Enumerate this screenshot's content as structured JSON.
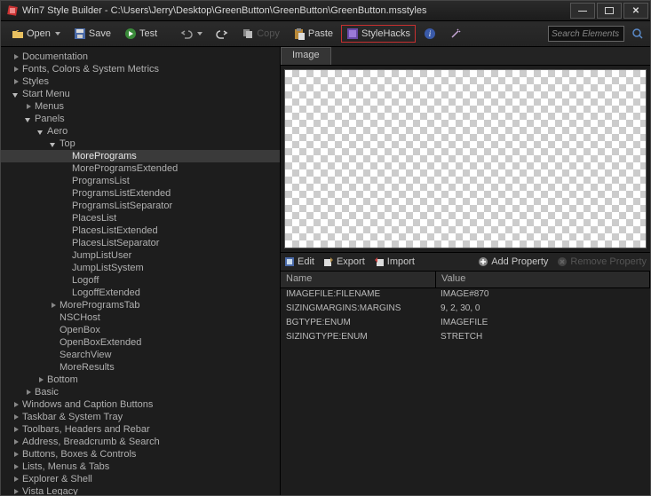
{
  "title": "Win7 Style Builder - C:\\Users\\Jerry\\Desktop\\GreenButton\\GreenButton\\GreenButton.msstyles",
  "toolbar": {
    "open": "Open",
    "save": "Save",
    "test": "Test",
    "copy": "Copy",
    "paste": "Paste",
    "stylehacks": "StyleHacks"
  },
  "search": {
    "placeholder": "Search Elements"
  },
  "tree": [
    {
      "d": 0,
      "e": "c",
      "t": "Documentation"
    },
    {
      "d": 0,
      "e": "c",
      "t": "Fonts, Colors & System Metrics"
    },
    {
      "d": 0,
      "e": "c",
      "t": "Styles"
    },
    {
      "d": 0,
      "e": "o",
      "t": "Start Menu"
    },
    {
      "d": 1,
      "e": "c",
      "t": "Menus"
    },
    {
      "d": 1,
      "e": "o",
      "t": "Panels"
    },
    {
      "d": 2,
      "e": "o",
      "t": "Aero"
    },
    {
      "d": 3,
      "e": "o",
      "t": "Top"
    },
    {
      "d": 4,
      "e": "",
      "t": "MorePrograms",
      "sel": true
    },
    {
      "d": 4,
      "e": "",
      "t": "MoreProgramsExtended"
    },
    {
      "d": 4,
      "e": "",
      "t": "ProgramsList"
    },
    {
      "d": 4,
      "e": "",
      "t": "ProgramsListExtended"
    },
    {
      "d": 4,
      "e": "",
      "t": "ProgramsListSeparator"
    },
    {
      "d": 4,
      "e": "",
      "t": "PlacesList"
    },
    {
      "d": 4,
      "e": "",
      "t": "PlacesListExtended"
    },
    {
      "d": 4,
      "e": "",
      "t": "PlacesListSeparator"
    },
    {
      "d": 4,
      "e": "",
      "t": "JumpListUser"
    },
    {
      "d": 4,
      "e": "",
      "t": "JumpListSystem"
    },
    {
      "d": 4,
      "e": "",
      "t": "Logoff"
    },
    {
      "d": 4,
      "e": "",
      "t": "LogoffExtended"
    },
    {
      "d": 3,
      "e": "c",
      "t": "MoreProgramsTab"
    },
    {
      "d": 3,
      "e": "",
      "t": "NSCHost"
    },
    {
      "d": 3,
      "e": "",
      "t": "OpenBox"
    },
    {
      "d": 3,
      "e": "",
      "t": "OpenBoxExtended"
    },
    {
      "d": 3,
      "e": "",
      "t": "SearchView"
    },
    {
      "d": 3,
      "e": "",
      "t": "MoreResults"
    },
    {
      "d": 2,
      "e": "c",
      "t": "Bottom"
    },
    {
      "d": 1,
      "e": "c",
      "t": "Basic"
    },
    {
      "d": 0,
      "e": "c",
      "t": "Windows and Caption Buttons"
    },
    {
      "d": 0,
      "e": "c",
      "t": "Taskbar & System Tray"
    },
    {
      "d": 0,
      "e": "c",
      "t": "Toolbars, Headers and Rebar"
    },
    {
      "d": 0,
      "e": "c",
      "t": "Address, Breadcrumb & Search"
    },
    {
      "d": 0,
      "e": "c",
      "t": "Buttons, Boxes & Controls"
    },
    {
      "d": 0,
      "e": "c",
      "t": "Lists, Menus & Tabs"
    },
    {
      "d": 0,
      "e": "c",
      "t": "Explorer & Shell"
    },
    {
      "d": 0,
      "e": "c",
      "t": "Vista Legacy"
    }
  ],
  "imageTab": "Image",
  "propToolbar": {
    "edit": "Edit",
    "export": "Export",
    "import": "Import",
    "add": "Add Property",
    "remove": "Remove Property"
  },
  "propCols": {
    "name": "Name",
    "value": "Value"
  },
  "props": [
    {
      "n": "IMAGEFILE:FILENAME",
      "v": "IMAGE#870"
    },
    {
      "n": "SIZINGMARGINS:MARGINS",
      "v": "9, 2, 30, 0"
    },
    {
      "n": "BGTYPE:ENUM",
      "v": "IMAGEFILE"
    },
    {
      "n": "SIZINGTYPE:ENUM",
      "v": "STRETCH"
    }
  ],
  "win": {
    "min": "—",
    "close": "✕"
  }
}
